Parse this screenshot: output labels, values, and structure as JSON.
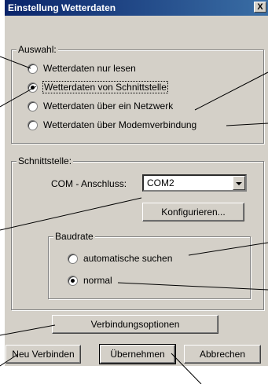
{
  "window": {
    "title": "Einstellung Wetterdaten",
    "close_label": "X"
  },
  "auswahl": {
    "legend": "Auswahl:",
    "options": [
      {
        "label": "Wetterdaten nur lesen",
        "checked": false
      },
      {
        "label": "Wetterdaten von Schnittstelle",
        "checked": true
      },
      {
        "label": "Wetterdaten über ein Netzwerk",
        "checked": false
      },
      {
        "label": "Wetterdaten über Modemverbindung",
        "checked": false
      }
    ]
  },
  "schnittstelle": {
    "legend": "Schnittstelle:",
    "com_label": "COM - Anschluss:",
    "com_value": "COM2",
    "configure_label": "Konfigurieren..."
  },
  "baudrate": {
    "legend": "Baudrate",
    "options": [
      {
        "label": "automatische suchen",
        "checked": false
      },
      {
        "label": "normal",
        "checked": true
      }
    ]
  },
  "buttons": {
    "verbindungsoptionen": "Verbindungsoptionen",
    "neu_verbinden": "Neu Verbinden",
    "uebernehmen": "Übernehmen",
    "abbrechen": "Abbrechen"
  }
}
